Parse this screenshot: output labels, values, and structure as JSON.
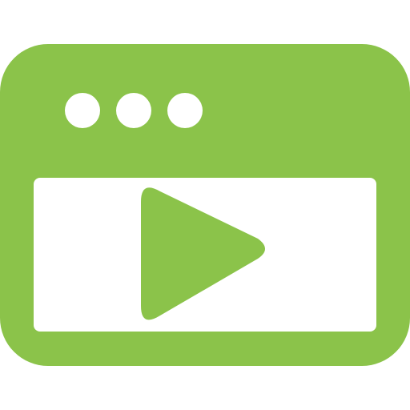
{
  "icon": {
    "name": "video-player-window-icon",
    "accent_color": "#8BC34A",
    "screen_color": "#FFFFFF",
    "window_dots_count": 3
  }
}
